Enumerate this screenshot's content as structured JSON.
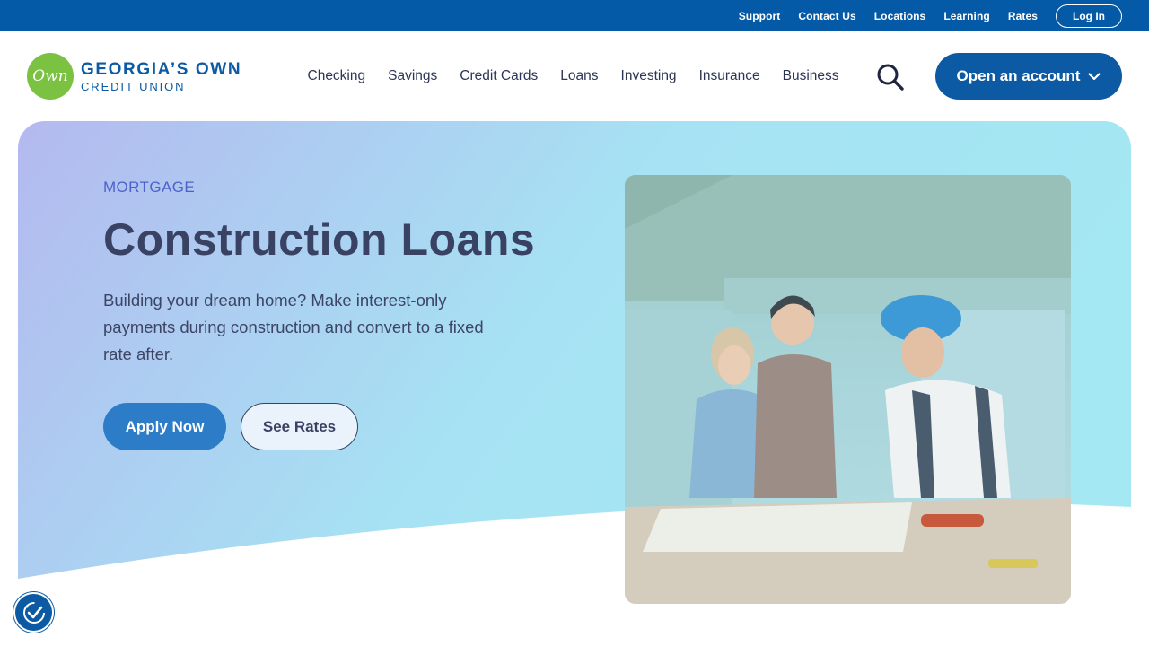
{
  "utility": {
    "links": [
      "Support",
      "Contact Us",
      "Locations",
      "Learning",
      "Rates"
    ],
    "login": "Log In"
  },
  "brand": {
    "mark": "Own",
    "name_line1": "GEORGIA’S OWN",
    "name_line2": "CREDIT UNION"
  },
  "nav": {
    "items": [
      "Checking",
      "Savings",
      "Credit Cards",
      "Loans",
      "Investing",
      "Insurance",
      "Business"
    ],
    "search_icon": "search-icon",
    "open_account": "Open an account"
  },
  "hero": {
    "eyebrow": "MORTGAGE",
    "title": "Construction Loans",
    "description": "Building your dream home? Make interest-only payments during construction and convert to a fixed rate after.",
    "apply_button": "Apply Now",
    "rates_button": "See Rates"
  },
  "colors": {
    "primary": "#0b5aa3",
    "utility_bar": "#045aa6",
    "brand_green": "#7cc242",
    "apply": "#2d7cc8",
    "hero_start": "#b4b9ef",
    "hero_end": "#a4e8f3"
  },
  "accessibility_icon": "accessibility-icon"
}
